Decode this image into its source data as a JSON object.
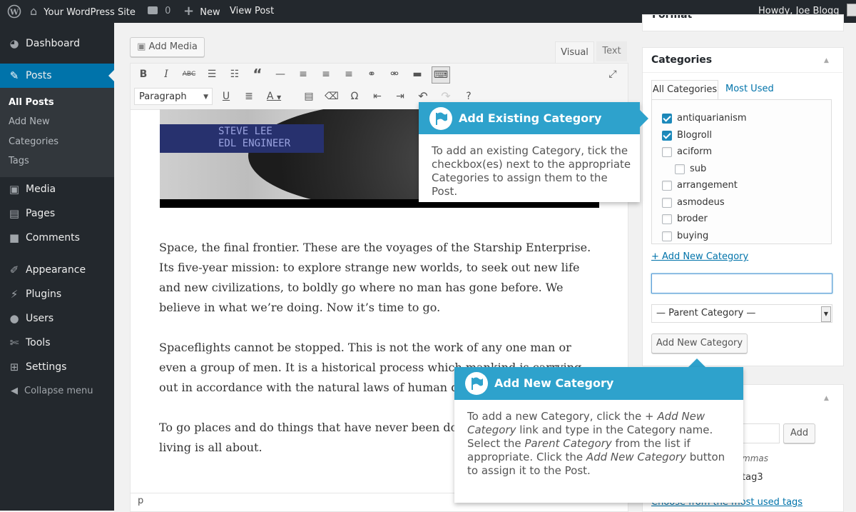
{
  "adminbar": {
    "site_name": "Your WordPress Site",
    "comments_count": "0",
    "new_label": "New",
    "view_post_label": "View Post",
    "howdy": "Howdy, Joe Blogg"
  },
  "sidebar": {
    "items": [
      {
        "label": "Dashboard",
        "icon": "dashboard-icon"
      },
      {
        "label": "Posts",
        "icon": "pin-icon"
      },
      {
        "label": "Media",
        "icon": "media-icon"
      },
      {
        "label": "Pages",
        "icon": "pages-icon"
      },
      {
        "label": "Comments",
        "icon": "comments-icon"
      },
      {
        "label": "Appearance",
        "icon": "brush-icon"
      },
      {
        "label": "Plugins",
        "icon": "plugin-icon"
      },
      {
        "label": "Users",
        "icon": "users-icon"
      },
      {
        "label": "Tools",
        "icon": "wrench-icon"
      },
      {
        "label": "Settings",
        "icon": "settings-icon"
      }
    ],
    "submenu": [
      "All Posts",
      "Add New",
      "Categories",
      "Tags"
    ],
    "collapse_label": "Collapse menu"
  },
  "editor": {
    "add_media_label": "Add Media",
    "tab_visual": "Visual",
    "tab_text": "Text",
    "format_select": "Paragraph",
    "image_caption_line1": "STEVE LEE",
    "image_caption_line2": "EDL ENGINEER",
    "paragraphs": [
      "Space, the final frontier. These are the voyages of the Starship Enterprise. Its five-year mission: to explore strange new worlds, to seek out new life and new civilizations, to boldly go where no man has gone before. We believe in what we’re doing. Now it’s time to go.",
      "Spaceflights cannot be stopped. This is not the work of any one man or even a group of men. It is a historical process which mankind is carrying out in accordance with the natural laws of human development.",
      "To go places and do things that have never been done before – that’s what living is all about."
    ],
    "path_label": "p"
  },
  "categories_box": {
    "top_partial": "Format",
    "title": "Categories",
    "tab_all": "All Categories",
    "tab_most_used": "Most Used",
    "items": [
      {
        "label": "antiquarianism",
        "checked": true,
        "indent": false
      },
      {
        "label": "Blogroll",
        "checked": true,
        "indent": false
      },
      {
        "label": "aciform",
        "checked": false,
        "indent": false
      },
      {
        "label": "sub",
        "checked": false,
        "indent": true
      },
      {
        "label": "arrangement",
        "checked": false,
        "indent": false
      },
      {
        "label": "asmodeus",
        "checked": false,
        "indent": false
      },
      {
        "label": "broder",
        "checked": false,
        "indent": false
      },
      {
        "label": "buying",
        "checked": false,
        "indent": false
      }
    ],
    "add_new_link": "+ Add New Category",
    "new_category_value": "",
    "parent_select": "— Parent Category —",
    "add_button": "Add New Category"
  },
  "tags_box": {
    "add_button": "Add",
    "hint_partial": "mmas",
    "tag_partial": "tag3",
    "choose_link": "Choose from the most used tags"
  },
  "pointer_existing": {
    "title": "Add Existing Category",
    "body": "To add an existing Category, tick the checkbox(es) next to the appropriate Categories to assign them to the Post."
  },
  "pointer_new": {
    "title": "Add New Category",
    "body_1": "To add a new Category, click the ",
    "body_2": "+ Add New Category",
    "body_3": " link and type in the Category name. Select the ",
    "body_4": "Parent Category",
    "body_5": " from the list if appropriate. Click the ",
    "body_6": "Add New Category",
    "body_7": " button to assign it to the Post."
  },
  "colors": {
    "accent": "#0073aa",
    "menu_active": "#0073aa",
    "pointer_header": "#2ea2cc",
    "adminbar": "#23282d"
  }
}
